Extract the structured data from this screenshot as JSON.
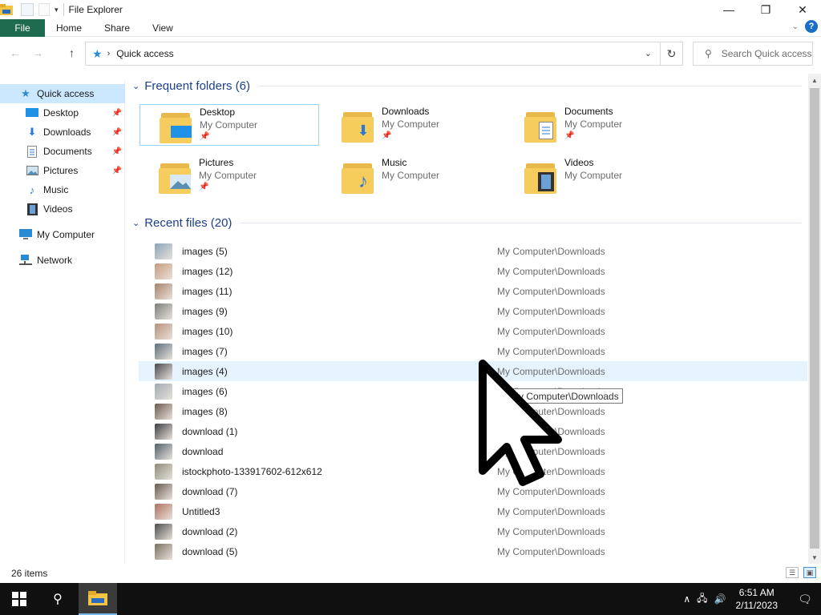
{
  "window": {
    "title": "File Explorer",
    "minimize": "—",
    "maximize": "❐",
    "close": "✕"
  },
  "ribbon": {
    "tabs": [
      "File",
      "Home",
      "Share",
      "View"
    ],
    "help": "?"
  },
  "address": {
    "path": "Quick access",
    "search_placeholder": "Search Quick access"
  },
  "sidebar": {
    "items": [
      {
        "label": "Quick access",
        "icon": "star-icon",
        "pinned": false,
        "active": true
      },
      {
        "label": "Desktop",
        "icon": "desktop-icon",
        "pinned": true
      },
      {
        "label": "Downloads",
        "icon": "download-arrow-icon",
        "pinned": true
      },
      {
        "label": "Documents",
        "icon": "documents-icon",
        "pinned": true
      },
      {
        "label": "Pictures",
        "icon": "pictures-icon",
        "pinned": true
      },
      {
        "label": "Music",
        "icon": "music-icon",
        "pinned": false
      },
      {
        "label": "Videos",
        "icon": "videos-icon",
        "pinned": false
      },
      {
        "label": "My Computer",
        "icon": "computer-icon",
        "pinned": false
      },
      {
        "label": "Network",
        "icon": "network-icon",
        "pinned": false
      }
    ]
  },
  "frequent": {
    "title": "Frequent folders (6)",
    "folders": [
      {
        "name": "Desktop",
        "location": "My Computer",
        "icon": "desktop-icon",
        "pinned": true
      },
      {
        "name": "Downloads",
        "location": "My Computer",
        "icon": "download-arrow-icon",
        "pinned": true
      },
      {
        "name": "Documents",
        "location": "My Computer",
        "icon": "documents-icon",
        "pinned": true
      },
      {
        "name": "Pictures",
        "location": "My Computer",
        "icon": "pictures-icon",
        "pinned": true
      },
      {
        "name": "Music",
        "location": "My Computer",
        "icon": "music-icon",
        "pinned": false
      },
      {
        "name": "Videos",
        "location": "My Computer",
        "icon": "videos-icon",
        "pinned": false
      }
    ]
  },
  "recent": {
    "title": "Recent files (20)",
    "files": [
      {
        "name": "images (5)",
        "location": "My Computer\\Downloads"
      },
      {
        "name": "images (12)",
        "location": "My Computer\\Downloads"
      },
      {
        "name": "images (11)",
        "location": "My Computer\\Downloads"
      },
      {
        "name": "images (9)",
        "location": "My Computer\\Downloads"
      },
      {
        "name": "images (10)",
        "location": "My Computer\\Downloads"
      },
      {
        "name": "images (7)",
        "location": "My Computer\\Downloads"
      },
      {
        "name": "images (4)",
        "location": "My Computer\\Downloads"
      },
      {
        "name": "images (6)",
        "location": "My Computer\\Downloads"
      },
      {
        "name": "images (8)",
        "location": "My Computer\\Downloads"
      },
      {
        "name": "download (1)",
        "location": "My Computer\\Downloads"
      },
      {
        "name": "download",
        "location": "My Computer\\Downloads"
      },
      {
        "name": "istockphoto-133917602-612x612",
        "location": "My Computer\\Downloads"
      },
      {
        "name": "download (7)",
        "location": "My Computer\\Downloads"
      },
      {
        "name": "Untitled3",
        "location": "My Computer\\Downloads"
      },
      {
        "name": "download (2)",
        "location": "My Computer\\Downloads"
      },
      {
        "name": "download (5)",
        "location": "My Computer\\Downloads"
      }
    ],
    "tooltip": "My Computer\\Downloads"
  },
  "status": {
    "items": "26 items"
  },
  "taskbar": {
    "time": "6:51 AM",
    "date": "2/11/2023"
  },
  "colors": {
    "file_tab": "#1e6b4f",
    "group_header": "#1e3f8a",
    "selection": "#cce8ff",
    "hover_row": "#e5f3ff",
    "accent": "#2a8ad4"
  }
}
